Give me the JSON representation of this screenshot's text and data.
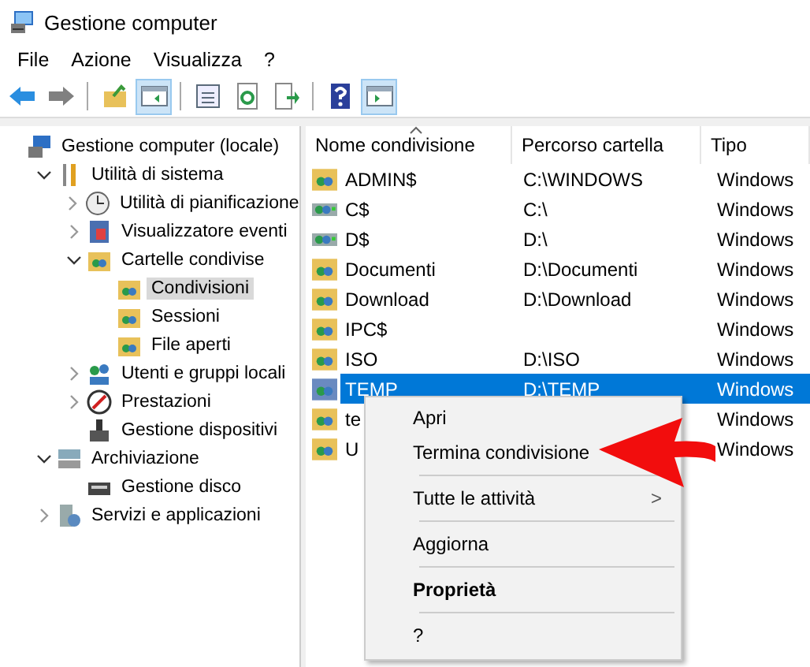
{
  "window": {
    "title": "Gestione computer"
  },
  "menu": [
    "File",
    "Azione",
    "Visualizza",
    "?"
  ],
  "toolbar": [
    [
      {
        "pressed": false
      },
      {
        "pressed": false
      }
    ],
    [
      {
        "pressed": false
      },
      {
        "pressed": true
      }
    ],
    [
      {
        "pressed": false
      },
      {
        "pressed": false
      },
      {
        "pressed": false
      }
    ],
    [
      {
        "pressed": false
      },
      {
        "pressed": true
      }
    ]
  ],
  "tree": [
    {
      "label": "Gestione computer (locale)",
      "selected": false,
      "children": [
        {
          "label": "Utilità di sistema",
          "selected": false,
          "expanded": true,
          "children": [
            {
              "label": "Utilità di pianificazione",
              "selected": false,
              "expanded": false
            },
            {
              "label": "Visualizzatore eventi",
              "selected": false,
              "expanded": false
            },
            {
              "label": "Cartelle condivise",
              "selected": false,
              "expanded": true,
              "children": [
                {
                  "label": "Condivisioni",
                  "selected": true
                },
                {
                  "label": "Sessioni",
                  "selected": false
                },
                {
                  "label": "File aperti",
                  "selected": false
                }
              ]
            },
            {
              "label": "Utenti e gruppi locali",
              "selected": false,
              "expanded": false
            },
            {
              "label": "Prestazioni",
              "selected": false,
              "expanded": false
            },
            {
              "label": "Gestione dispositivi",
              "selected": false
            }
          ]
        },
        {
          "label": "Archiviazione",
          "selected": false,
          "expanded": true,
          "children": [
            {
              "label": "Gestione disco",
              "selected": false
            }
          ]
        },
        {
          "label": "Servizi e applicazioni",
          "selected": false,
          "expanded": false
        }
      ]
    }
  ],
  "table": {
    "columns": [
      "Nome condivisione",
      "Percorso cartella",
      "Tipo"
    ],
    "rows": [
      {
        "kind": "folder",
        "selected": false,
        "cells": [
          "ADMIN$",
          "C:\\WINDOWS",
          "Windows"
        ]
      },
      {
        "kind": "drive",
        "selected": false,
        "cells": [
          "C$",
          "C:\\",
          "Windows"
        ]
      },
      {
        "kind": "drive",
        "selected": false,
        "cells": [
          "D$",
          "D:\\",
          "Windows"
        ]
      },
      {
        "kind": "folder",
        "selected": false,
        "cells": [
          "Documenti",
          "D:\\Documenti",
          "Windows"
        ]
      },
      {
        "kind": "folder",
        "selected": false,
        "cells": [
          "Download",
          "D:\\Download",
          "Windows"
        ]
      },
      {
        "kind": "folder",
        "selected": false,
        "cells": [
          "IPC$",
          "",
          "Windows"
        ]
      },
      {
        "kind": "folder",
        "selected": false,
        "cells": [
          "ISO",
          "D:\\ISO",
          "Windows"
        ]
      },
      {
        "kind": "folder",
        "selected": true,
        "cells": [
          "TEMP",
          "D:\\TEMP",
          "Windows"
        ]
      },
      {
        "kind": "folder",
        "selected": false,
        "cells": [
          "te",
          "",
          "Windows"
        ]
      },
      {
        "kind": "folder",
        "selected": false,
        "cells": [
          "U",
          "",
          "Windows"
        ]
      }
    ]
  },
  "context_menu": {
    "items": [
      {
        "kind": "item",
        "label": "Apri"
      },
      {
        "kind": "item",
        "label": "Termina condivisione"
      },
      {
        "kind": "separator"
      },
      {
        "kind": "submenu",
        "label": "Tutte le attività",
        "arrow": ">"
      },
      {
        "kind": "separator"
      },
      {
        "kind": "item",
        "label": "Aggiorna"
      },
      {
        "kind": "separator"
      },
      {
        "kind": "default",
        "label": "Proprietà"
      },
      {
        "kind": "separator"
      },
      {
        "kind": "item",
        "label": "?"
      }
    ]
  }
}
